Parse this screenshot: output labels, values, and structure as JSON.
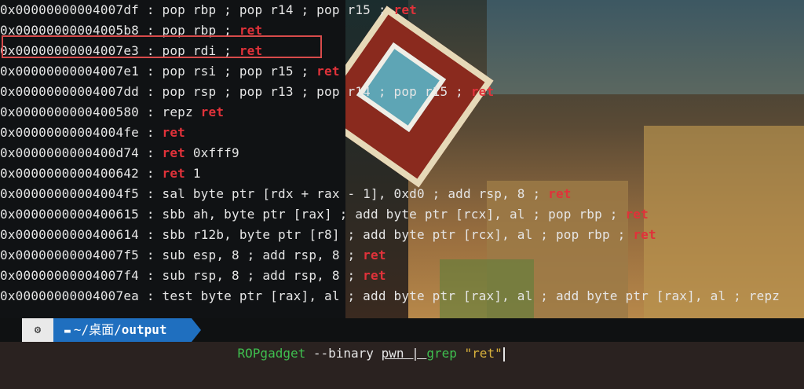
{
  "colors": {
    "keyword": "#e0323a",
    "highlight_box": "#d84b4b",
    "path_bg": "#1f6fbf",
    "program": "#3fbf4f",
    "string": "#d9b23c"
  },
  "gadgets": [
    {
      "addr": "0x00000000004007df",
      "instr": "pop rbp ; pop r14 ; pop r15 ; ",
      "kw": "ret",
      "tail": ""
    },
    {
      "addr": "0x00000000004005b8",
      "instr": "pop rbp ; ",
      "kw": "ret",
      "tail": ""
    },
    {
      "addr": "0x00000000004007e3",
      "instr": "pop rdi ; ",
      "kw": "ret",
      "tail": ""
    },
    {
      "addr": "0x00000000004007e1",
      "instr": "pop rsi ; pop r15 ; ",
      "kw": "ret",
      "tail": ""
    },
    {
      "addr": "0x00000000004007dd",
      "instr": "pop rsp ; pop r13 ; pop r14 ; pop r15 ; ",
      "kw": "ret",
      "tail": ""
    },
    {
      "addr": "0x0000000000400580",
      "instr": "repz ",
      "kw": "ret",
      "tail": ""
    },
    {
      "addr": "0x00000000004004fe",
      "instr": "",
      "kw": "ret",
      "tail": ""
    },
    {
      "addr": "0x0000000000400d74",
      "instr": "",
      "kw": "ret",
      "tail": " 0xfff9"
    },
    {
      "addr": "0x0000000000400642",
      "instr": "",
      "kw": "ret",
      "tail": " 1"
    },
    {
      "addr": "0x00000000004004f5",
      "instr": "sal byte ptr [rdx + rax - 1], 0xd0 ; add rsp, 8 ; ",
      "kw": "ret",
      "tail": ""
    },
    {
      "addr": "0x0000000000400615",
      "instr": "sbb ah, byte ptr [rax] ; add byte ptr [rcx], al ; pop rbp ; ",
      "kw": "ret",
      "tail": ""
    },
    {
      "addr": "0x0000000000400614",
      "instr": "sbb r12b, byte ptr [r8] ; add byte ptr [rcx], al ; pop rbp ; ",
      "kw": "ret",
      "tail": ""
    },
    {
      "addr": "0x00000000004007f5",
      "instr": "sub esp, 8 ; add rsp, 8 ; ",
      "kw": "ret",
      "tail": ""
    },
    {
      "addr": "0x00000000004007f4",
      "instr": "sub rsp, 8 ; add rsp, 8 ; ",
      "kw": "ret",
      "tail": ""
    },
    {
      "addr": "0x00000000004007ea",
      "instr": "test byte ptr [rax], al ; add byte ptr [rax], al ; add byte ptr [rax], al ; ",
      "kw": "",
      "tail": "repz"
    }
  ],
  "separator": " : ",
  "prompt": {
    "icon": "linux-icon",
    "path_prefix": "~/桌面/",
    "path_dir": "output",
    "command_program": "ROPgadget",
    "command_args": " --binary ",
    "command_file": "pwn",
    "command_pipe": " | ",
    "command_grep": "grep",
    "command_string": " \"ret\""
  }
}
